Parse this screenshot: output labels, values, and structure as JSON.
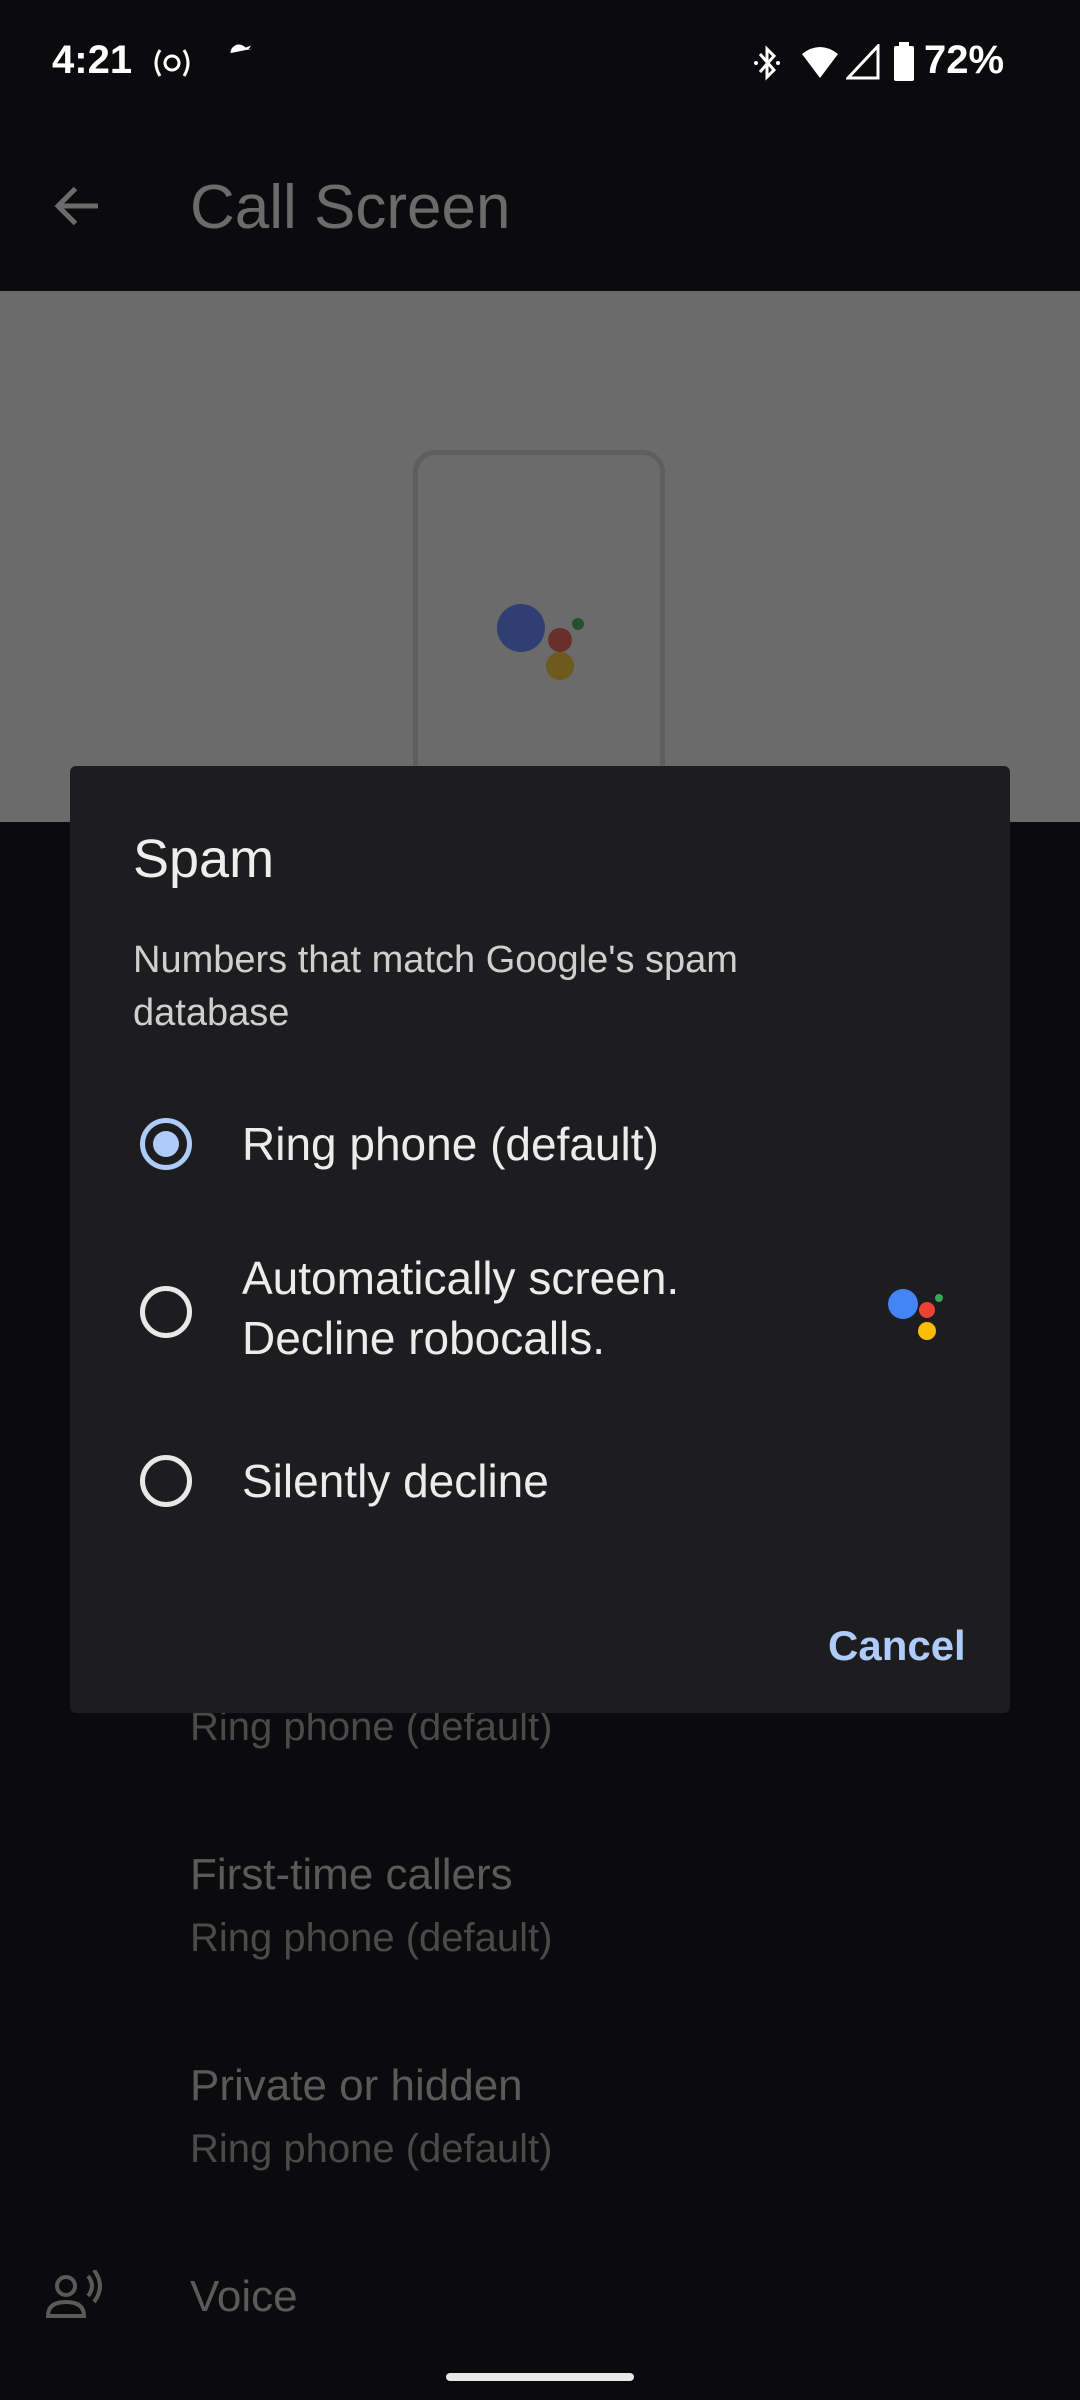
{
  "status_bar": {
    "time": "4:21",
    "battery": "72%",
    "icons": [
      "hotspot-icon",
      "twitter-icon",
      "bluetooth-icon",
      "wifi-icon",
      "signal-icon",
      "battery-icon"
    ]
  },
  "toolbar": {
    "title": "Call Screen",
    "back_icon": "arrow-left-icon"
  },
  "background_list": [
    {
      "subtitle": "Ring phone (default)"
    },
    {
      "title": "First-time callers",
      "subtitle": "Ring phone (default)"
    },
    {
      "title": "Private or hidden",
      "subtitle": "Ring phone (default)"
    },
    {
      "title": "Voice",
      "icon": "voice-person-icon"
    }
  ],
  "dialog": {
    "title": "Spam",
    "description": "Numbers that match Google's spam database",
    "options": [
      {
        "label": "Ring phone (default)",
        "selected": true
      },
      {
        "label": "Automatically screen. Decline robocalls.",
        "line1": "Automatically screen.",
        "line2": "Decline robocalls.",
        "selected": false,
        "icon": "google-assistant-icon"
      },
      {
        "label": "Silently decline",
        "selected": false
      }
    ],
    "cancel_label": "Cancel"
  },
  "colors": {
    "accent": "#aecbfa",
    "dialog_bg": "#1d1d1f",
    "assistant": [
      "#4285f4",
      "#ea4335",
      "#fbbc04",
      "#34a853"
    ]
  }
}
